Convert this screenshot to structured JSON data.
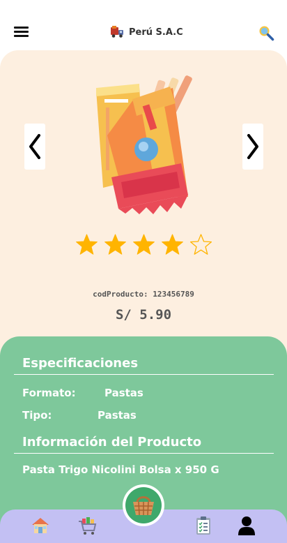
{
  "header": {
    "brand_title": "Perú S.A.C"
  },
  "product": {
    "rating": 4,
    "rating_max": 5,
    "code_label": "codProducto:",
    "code_value": "123456789",
    "price": "S/ 5.90"
  },
  "specs": {
    "section_title": "Especificaciones",
    "format_label": "Formato:",
    "format_value": "Pastas",
    "type_label": "Tipo:",
    "type_value": "Pastas",
    "info_title": "Información del Producto",
    "description": "Pasta Trigo Nicolini Bolsa x 950 G"
  },
  "icons": {
    "menu": "hamburger-icon",
    "brand": "delivery-truck-icon",
    "search": "search-icon",
    "prev": "chevron-left-icon",
    "next": "chevron-right-icon",
    "home": "home-icon",
    "cart": "cart-icon",
    "basket": "basket-icon",
    "orders": "clipboard-list-icon",
    "profile": "user-icon"
  },
  "colors": {
    "product_bg": "#fdefe0",
    "specs_bg": "#7ec89b",
    "bottom_nav_bg": "#c3c0f3",
    "star_filled": "#ffb400",
    "basket_accent": "#3fa86b"
  }
}
